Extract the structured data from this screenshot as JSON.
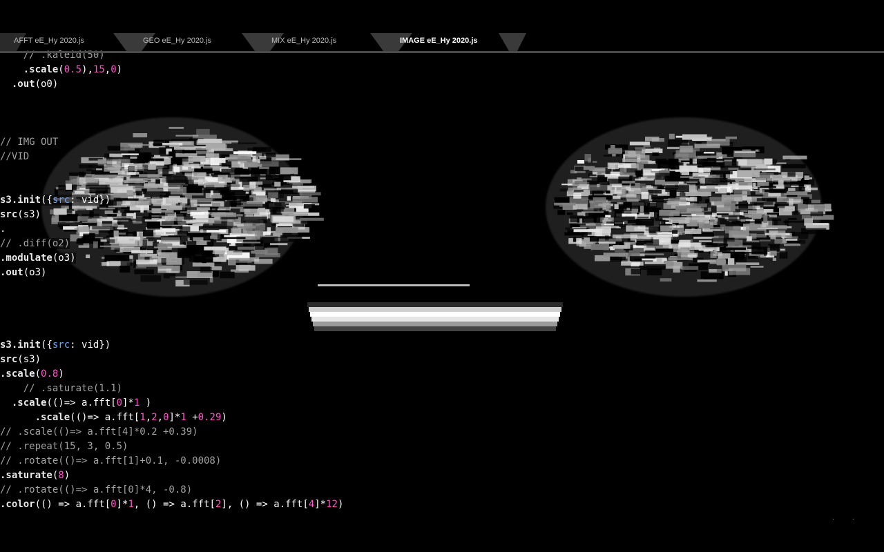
{
  "colors": {
    "background": "#000000",
    "method": "#e9e9e9",
    "number": "#ff57c8",
    "key": "#6fa3ff",
    "comment": "#a2a2a2",
    "tab_active": "#ffffff",
    "tab_inactive": "#b9b9b9"
  },
  "tabs": [
    {
      "label": "AFFT eE_Hy 2020.js",
      "active": false
    },
    {
      "label": "GEO eE_Hy 2020.js",
      "active": false
    },
    {
      "label": "MIX eE_Hy 2020.js",
      "active": false
    },
    {
      "label": "IMAGE eE_Hy 2020.js",
      "active": true
    }
  ],
  "code": [
    [
      [
        "comment",
        "    // .kaleid(50)"
      ]
    ],
    [
      [
        "plain",
        "    "
      ],
      [
        "method",
        ".scale"
      ],
      [
        "plain",
        "("
      ],
      [
        "num",
        "0.5"
      ],
      [
        "plain",
        "),"
      ],
      [
        "num",
        "15"
      ],
      [
        "plain",
        ","
      ],
      [
        "num",
        "0"
      ],
      [
        "plain",
        ")"
      ]
    ],
    [
      [
        "plain",
        "  "
      ],
      [
        "method",
        ".out"
      ],
      [
        "plain",
        "(o0)"
      ]
    ],
    [],
    [],
    [],
    [
      [
        "comment",
        "// IMG OUT"
      ]
    ],
    [
      [
        "comment",
        "//VID"
      ]
    ],
    [],
    [],
    [
      [
        "method",
        "s3.init"
      ],
      [
        "plain",
        "({"
      ],
      [
        "key",
        "src"
      ],
      [
        "plain",
        ": vid})"
      ]
    ],
    [
      [
        "method",
        "src"
      ],
      [
        "plain",
        "(s3)"
      ]
    ],
    [
      [
        "plain",
        "."
      ]
    ],
    [
      [
        "comment",
        "// .diff(o2)"
      ]
    ],
    [
      [
        "method",
        ".modulate"
      ],
      [
        "plain",
        "(o3)"
      ]
    ],
    [
      [
        "method",
        ".out"
      ],
      [
        "plain",
        "(o3)"
      ]
    ],
    [],
    [],
    [],
    [],
    [
      [
        "method",
        "s3.init"
      ],
      [
        "plain",
        "({"
      ],
      [
        "key",
        "src"
      ],
      [
        "plain",
        ": vid})"
      ]
    ],
    [
      [
        "method",
        "src"
      ],
      [
        "plain",
        "(s3)"
      ]
    ],
    [
      [
        "method",
        ".scale"
      ],
      [
        "plain",
        "("
      ],
      [
        "num",
        "0.8"
      ],
      [
        "plain",
        ")"
      ]
    ],
    [
      [
        "comment",
        "    // .saturate(1.1)"
      ]
    ],
    [
      [
        "plain",
        "  "
      ],
      [
        "method",
        ".scale"
      ],
      [
        "plain",
        "(()=> a.fft["
      ],
      [
        "num",
        "0"
      ],
      [
        "plain",
        "]*"
      ],
      [
        "num",
        "1"
      ],
      [
        "plain",
        " )"
      ]
    ],
    [
      [
        "plain",
        "      "
      ],
      [
        "method",
        ".scale"
      ],
      [
        "plain",
        "(()=> a.fft["
      ],
      [
        "num",
        "1"
      ],
      [
        "plain",
        ","
      ],
      [
        "num",
        "2"
      ],
      [
        "plain",
        ","
      ],
      [
        "num",
        "0"
      ],
      [
        "plain",
        "]*"
      ],
      [
        "num",
        "1"
      ],
      [
        "plain",
        " +"
      ],
      [
        "num",
        "0.29"
      ],
      [
        "plain",
        ")"
      ]
    ],
    [
      [
        "comment",
        "// .scale(()=> a.fft[4]*0.2 +0.39)"
      ]
    ],
    [
      [
        "comment",
        "// .repeat(15, 3, 0.5)"
      ]
    ],
    [
      [
        "comment",
        "// .rotate(()=> a.fft[1]+0.1, -0.0008)"
      ]
    ],
    [
      [
        "method",
        ".saturate"
      ],
      [
        "plain",
        "("
      ],
      [
        "num",
        "8"
      ],
      [
        "plain",
        ")"
      ]
    ],
    [
      [
        "comment",
        "// .rotate(()=> a.fft[0]*4, -0.8)"
      ]
    ],
    [
      [
        "method",
        ".color"
      ],
      [
        "plain",
        "(() => a.fft["
      ],
      [
        "num",
        "0"
      ],
      [
        "plain",
        "]*"
      ],
      [
        "num",
        "1"
      ],
      [
        "plain",
        ", () => a.fft["
      ],
      [
        "num",
        "2"
      ],
      [
        "plain",
        "], () => a.fft["
      ],
      [
        "num",
        "4"
      ],
      [
        "plain",
        "]*"
      ],
      [
        "num",
        "12"
      ],
      [
        "plain",
        ")"
      ]
    ]
  ]
}
